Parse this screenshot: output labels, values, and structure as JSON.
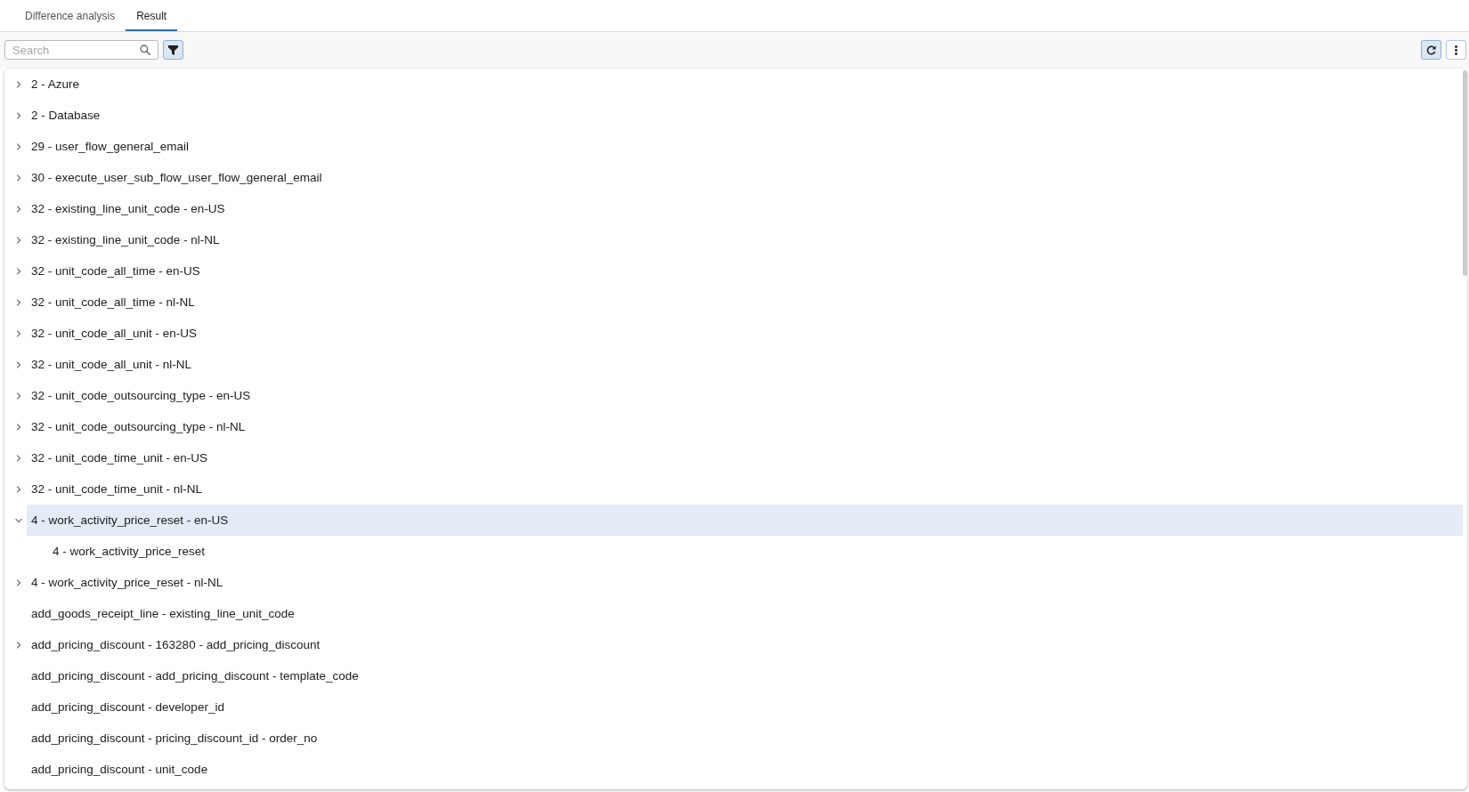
{
  "tabs": [
    {
      "label": "Difference analysis",
      "selected": false
    },
    {
      "label": "Result",
      "selected": true
    }
  ],
  "toolbar": {
    "search": {
      "placeholder": "Search"
    },
    "left_buttons": [
      {
        "kind": "filter",
        "pressed": true
      }
    ],
    "right_buttons": [
      {
        "kind": "refresh",
        "pressed": true
      },
      {
        "kind": "more",
        "pressed": false
      }
    ]
  },
  "tree": {
    "items": [
      {
        "label": "2 - Azure",
        "expandable": true,
        "expanded": false,
        "selected": false
      },
      {
        "label": "2 - Database",
        "expandable": true,
        "expanded": false,
        "selected": false
      },
      {
        "label": "29 - user_flow_general_email",
        "expandable": true,
        "expanded": false,
        "selected": false
      },
      {
        "label": "30 - execute_user_sub_flow_user_flow_general_email",
        "expandable": true,
        "expanded": false,
        "selected": false
      },
      {
        "label": "32 - existing_line_unit_code - en-US",
        "expandable": true,
        "expanded": false,
        "selected": false
      },
      {
        "label": "32 - existing_line_unit_code - nl-NL",
        "expandable": true,
        "expanded": false,
        "selected": false
      },
      {
        "label": "32 - unit_code_all_time - en-US",
        "expandable": true,
        "expanded": false,
        "selected": false
      },
      {
        "label": "32 - unit_code_all_time - nl-NL",
        "expandable": true,
        "expanded": false,
        "selected": false
      },
      {
        "label": "32 - unit_code_all_unit - en-US",
        "expandable": true,
        "expanded": false,
        "selected": false
      },
      {
        "label": "32 - unit_code_all_unit - nl-NL",
        "expandable": true,
        "expanded": false,
        "selected": false
      },
      {
        "label": "32 - unit_code_outsourcing_type - en-US",
        "expandable": true,
        "expanded": false,
        "selected": false
      },
      {
        "label": "32 - unit_code_outsourcing_type - nl-NL",
        "expandable": true,
        "expanded": false,
        "selected": false
      },
      {
        "label": "32 - unit_code_time_unit - en-US",
        "expandable": true,
        "expanded": false,
        "selected": false
      },
      {
        "label": "32 - unit_code_time_unit - nl-NL",
        "expandable": true,
        "expanded": false,
        "selected": false
      },
      {
        "label": "4 - work_activity_price_reset - en-US",
        "expandable": true,
        "expanded": true,
        "selected": true,
        "children": [
          {
            "label": "4 - work_activity_price_reset",
            "expandable": false,
            "expanded": false,
            "selected": false
          }
        ]
      },
      {
        "label": "4 - work_activity_price_reset - nl-NL",
        "expandable": true,
        "expanded": false,
        "selected": false
      },
      {
        "label": "add_goods_receipt_line - existing_line_unit_code",
        "expandable": false,
        "expanded": false,
        "selected": false
      },
      {
        "label": "add_pricing_discount - 163280 - add_pricing_discount",
        "expandable": true,
        "expanded": false,
        "selected": false
      },
      {
        "label": "add_pricing_discount - add_pricing_discount - template_code",
        "expandable": false,
        "expanded": false,
        "selected": false
      },
      {
        "label": "add_pricing_discount - developer_id",
        "expandable": false,
        "expanded": false,
        "selected": false
      },
      {
        "label": "add_pricing_discount - pricing_discount_id - order_no",
        "expandable": false,
        "expanded": false,
        "selected": false
      },
      {
        "label": "add_pricing_discount - unit_code",
        "expandable": false,
        "expanded": false,
        "selected": false
      }
    ]
  }
}
